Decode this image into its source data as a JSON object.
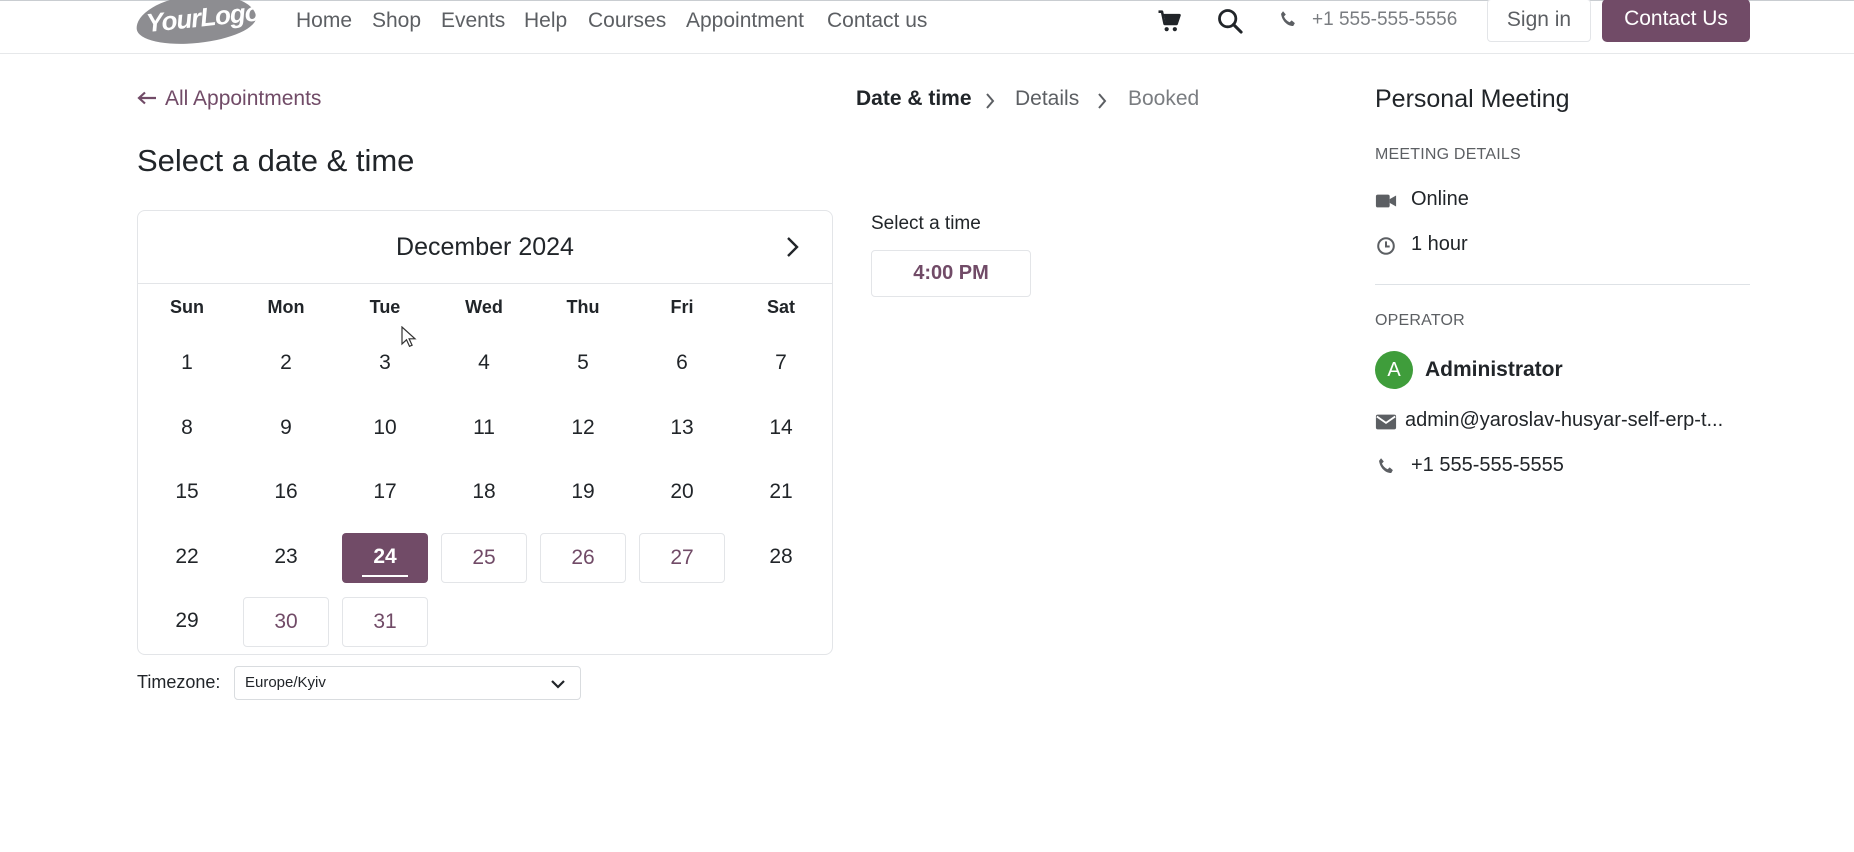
{
  "header": {
    "logo_text": "YourLogo",
    "nav": [
      "Home",
      "Shop",
      "Events",
      "Help",
      "Courses",
      "Appointment",
      "Contact us"
    ],
    "icons": [
      "cart-icon",
      "search-icon",
      "phone-icon"
    ],
    "phone": "+1 555-555-5556",
    "signin_label": "Sign in",
    "contact_label": "Contact Us"
  },
  "breadcrumb": {
    "back_label": "All Appointments",
    "steps": [
      "Date & time",
      "Details",
      "Booked"
    ],
    "active_step": "Date & time"
  },
  "page_title": "Select a date & time",
  "calendar": {
    "month_label": "December 2024",
    "weekdays": [
      "Sun",
      "Mon",
      "Tue",
      "Wed",
      "Thu",
      "Fri",
      "Sat"
    ],
    "weeks": [
      [
        "1",
        "2",
        "3",
        "4",
        "5",
        "6",
        "7"
      ],
      [
        "8",
        "9",
        "10",
        "11",
        "12",
        "13",
        "14"
      ],
      [
        "15",
        "16",
        "17",
        "18",
        "19",
        "20",
        "21"
      ],
      [
        "22",
        "23",
        "24",
        "25",
        "26",
        "27",
        "28"
      ],
      [
        "29",
        "30",
        "31",
        "",
        "",
        "",
        ""
      ]
    ],
    "selected_day": "24",
    "available_days": [
      "25",
      "26",
      "27",
      "30",
      "31"
    ]
  },
  "timezone": {
    "label": "Timezone:",
    "value": "Europe/Kyiv"
  },
  "time_selection": {
    "label": "Select a time",
    "slots": [
      "4:00 PM"
    ]
  },
  "sidebar": {
    "title": "Personal Meeting",
    "meeting_details_heading": "MEETING DETAILS",
    "location": "Online",
    "duration": "1 hour",
    "operator_heading": "OPERATOR",
    "operator_initial": "A",
    "operator_name": "Administrator",
    "operator_email": "admin@yaroslav-husyar-self-erp-t...",
    "operator_phone": "+1 555-555-5555"
  },
  "colors": {
    "brand": "#714b67",
    "avatar": "#3f9d3b"
  }
}
